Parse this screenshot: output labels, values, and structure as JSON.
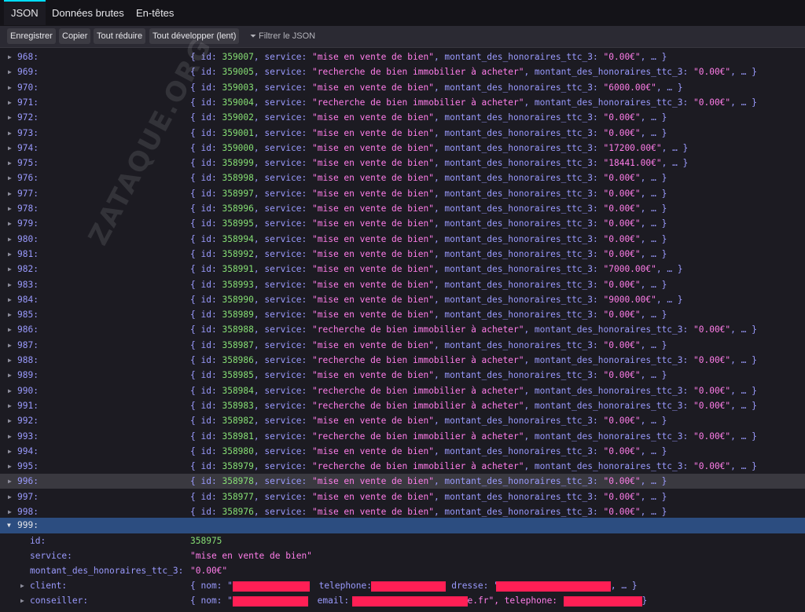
{
  "tabs": [
    {
      "label": "JSON"
    },
    {
      "label": "Données brutes"
    },
    {
      "label": "En-têtes"
    }
  ],
  "toolbar": {
    "save": "Enregistrer",
    "copy": "Copier",
    "collapse": "Tout réduire",
    "expand": "Tout développer (lent)",
    "filter_placeholder": "Filtrer le JSON"
  },
  "rows": [
    {
      "idx": "968:",
      "id": "359007",
      "service": "\"mise en vente de bien\"",
      "montant": "\"0.00€\""
    },
    {
      "idx": "969:",
      "id": "359005",
      "service": "\"recherche de bien immobilier à acheter\"",
      "montant": "\"0.00€\""
    },
    {
      "idx": "970:",
      "id": "359003",
      "service": "\"mise en vente de bien\"",
      "montant": "\"6000.00€\""
    },
    {
      "idx": "971:",
      "id": "359004",
      "service": "\"recherche de bien immobilier à acheter\"",
      "montant": "\"0.00€\""
    },
    {
      "idx": "972:",
      "id": "359002",
      "service": "\"mise en vente de bien\"",
      "montant": "\"0.00€\""
    },
    {
      "idx": "973:",
      "id": "359001",
      "service": "\"mise en vente de bien\"",
      "montant": "\"0.00€\""
    },
    {
      "idx": "974:",
      "id": "359000",
      "service": "\"mise en vente de bien\"",
      "montant": "\"17200.00€\""
    },
    {
      "idx": "975:",
      "id": "358999",
      "service": "\"mise en vente de bien\"",
      "montant": "\"18441.00€\""
    },
    {
      "idx": "976:",
      "id": "358998",
      "service": "\"mise en vente de bien\"",
      "montant": "\"0.00€\""
    },
    {
      "idx": "977:",
      "id": "358997",
      "service": "\"mise en vente de bien\"",
      "montant": "\"0.00€\""
    },
    {
      "idx": "978:",
      "id": "358996",
      "service": "\"mise en vente de bien\"",
      "montant": "\"0.00€\""
    },
    {
      "idx": "979:",
      "id": "358995",
      "service": "\"mise en vente de bien\"",
      "montant": "\"0.00€\""
    },
    {
      "idx": "980:",
      "id": "358994",
      "service": "\"mise en vente de bien\"",
      "montant": "\"0.00€\""
    },
    {
      "idx": "981:",
      "id": "358992",
      "service": "\"mise en vente de bien\"",
      "montant": "\"0.00€\""
    },
    {
      "idx": "982:",
      "id": "358991",
      "service": "\"mise en vente de bien\"",
      "montant": "\"7000.00€\""
    },
    {
      "idx": "983:",
      "id": "358993",
      "service": "\"mise en vente de bien\"",
      "montant": "\"0.00€\""
    },
    {
      "idx": "984:",
      "id": "358990",
      "service": "\"mise en vente de bien\"",
      "montant": "\"9000.00€\""
    },
    {
      "idx": "985:",
      "id": "358989",
      "service": "\"mise en vente de bien\"",
      "montant": "\"0.00€\""
    },
    {
      "idx": "986:",
      "id": "358988",
      "service": "\"recherche de bien immobilier à acheter\"",
      "montant": "\"0.00€\""
    },
    {
      "idx": "987:",
      "id": "358987",
      "service": "\"mise en vente de bien\"",
      "montant": "\"0.00€\""
    },
    {
      "idx": "988:",
      "id": "358986",
      "service": "\"recherche de bien immobilier à acheter\"",
      "montant": "\"0.00€\""
    },
    {
      "idx": "989:",
      "id": "358985",
      "service": "\"mise en vente de bien\"",
      "montant": "\"0.00€\""
    },
    {
      "idx": "990:",
      "id": "358984",
      "service": "\"recherche de bien immobilier à acheter\"",
      "montant": "\"0.00€\""
    },
    {
      "idx": "991:",
      "id": "358983",
      "service": "\"recherche de bien immobilier à acheter\"",
      "montant": "\"0.00€\""
    },
    {
      "idx": "992:",
      "id": "358982",
      "service": "\"mise en vente de bien\"",
      "montant": "\"0.00€\""
    },
    {
      "idx": "993:",
      "id": "358981",
      "service": "\"recherche de bien immobilier à acheter\"",
      "montant": "\"0.00€\""
    },
    {
      "idx": "994:",
      "id": "358980",
      "service": "\"mise en vente de bien\"",
      "montant": "\"0.00€\""
    },
    {
      "idx": "995:",
      "id": "358979",
      "service": "\"recherche de bien immobilier à acheter\"",
      "montant": "\"0.00€\""
    },
    {
      "idx": "996:",
      "id": "358978",
      "service": "\"mise en vente de bien\"",
      "montant": "\"0.00€\""
    },
    {
      "idx": "997:",
      "id": "358977",
      "service": "\"mise en vente de bien\"",
      "montant": "\"0.00€\""
    },
    {
      "idx": "998:",
      "id": "358976",
      "service": "\"mise en vente de bien\"",
      "montant": "\"0.00€\""
    }
  ],
  "labels": {
    "id_key": "id:",
    "service_key": "service:",
    "montant_key": "montant_des_honoraires_ttc_3:",
    "open_brace": "{",
    "close_ellipsis": ", … }",
    "sep": ", "
  },
  "expanded": {
    "idx": "999:",
    "id_label": "id:",
    "id_value": "358975",
    "service_label": "service:",
    "service_value": "\"mise en vente de bien\"",
    "montant_label": "montant_des_honoraires_ttc_3:",
    "montant_value": "\"0.00€\"",
    "client_label": "client:",
    "client_nom": "{ nom: \"",
    "client_tel": "telephone: \"",
    "client_addr": "dresse: \"",
    "client_tail": ", … }",
    "conseiller_label": "conseiller:",
    "conseiller_nom": "{ nom: \"",
    "conseiller_email": "email: \"",
    "conseiller_email_end": "e.fr\", telephone: \"",
    "conseiller_tail": "}"
  },
  "watermark": "ZATAQUE.ORG",
  "colors": {
    "background": "#1c1b22",
    "key": "#9a9afd",
    "number": "#86de74",
    "string": "#ff7de9",
    "highlight_row": "#3a3940",
    "selected_row": "#2c4d80",
    "redaction": "#ff1f55",
    "active_tab_accent": "#00ddff"
  }
}
